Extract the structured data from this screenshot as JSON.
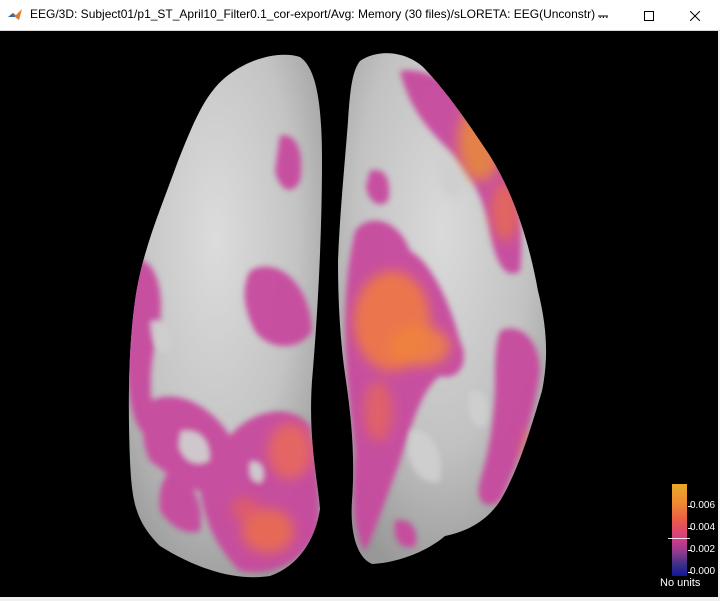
{
  "window": {
    "title": "EEG/3D: Subject01/p1_ST_April10_Filter0.1_cor-export/Avg: Memory (30 files)/sLORETA: EEG(Unconstr) ...",
    "controls": [
      "minimize",
      "maximize",
      "close"
    ]
  },
  "colorbar": {
    "ticks": [
      "0.006",
      "0.004",
      "0.002",
      "0.000"
    ],
    "tick_values": [
      0.006,
      0.004,
      0.002,
      0.0
    ],
    "units": "No units",
    "threshold_marker": 0.0028,
    "colors": [
      "#e8a82a",
      "#f08a33",
      "#ea5a48",
      "#d43a8a",
      "#8a3b8e",
      "#3a2f85",
      "#15159a"
    ]
  },
  "icons": {
    "app": "matlab-icon",
    "minimize": "minimize-icon",
    "maximize": "maximize-icon",
    "close": "close-icon"
  }
}
